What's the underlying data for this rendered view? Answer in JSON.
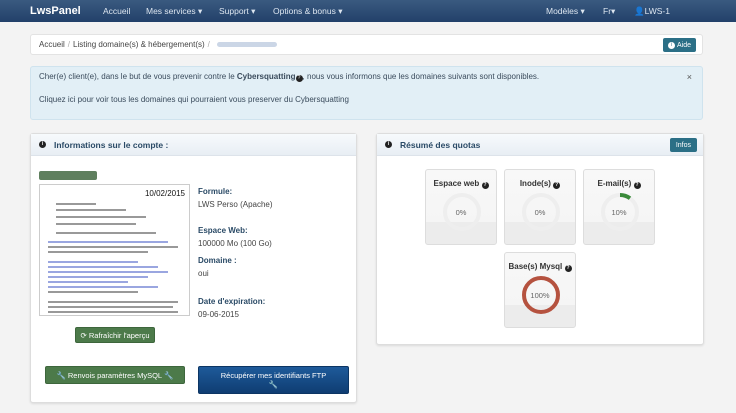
{
  "nav": {
    "brand": "LwsPanel",
    "items": [
      "Accueil",
      "Mes services ▾",
      "Support ▾",
      "Options & bonus ▾"
    ],
    "right": [
      "Modèles ▾",
      "Fr▾",
      "LWS-1"
    ]
  },
  "breadcrumb": {
    "items": [
      "Accueil",
      "Listing domaine(s) & hébergement(s)"
    ],
    "help": "Aide"
  },
  "alert": {
    "line1_pre": "Cher(e) client(e), dans le but de vous prevenir contre le ",
    "line1_bold": "Cybersquatting",
    "line1_post": ", nous vous informons que les domaines suivants sont disponibles.",
    "line2": "Cliquez ici pour voir tous les domaines qui pourraient vous preserver du Cybersquatting",
    "close": "×"
  },
  "account": {
    "title": "Informations sur le compte :",
    "preview_date": "10/02/2015",
    "refresh": "Rafraîchir l'aperçu",
    "fields": [
      {
        "label": "Formule:",
        "value": "LWS Perso (Apache)"
      },
      {
        "label": "Espace Web:",
        "value": "100000 Mo (100 Go)"
      },
      {
        "label": "Domaine :",
        "value": "oui"
      },
      {
        "label": "Date d'expiration:",
        "value": "09-06-2015"
      }
    ],
    "mysql_btn": "Renvois paramètres MySQL",
    "ftp_btn": "Récupérer mes identifiants FTP"
  },
  "quotas": {
    "title": "Résumé des quotas",
    "infos": "Infos",
    "colors": {
      "ok": "#3a8a3a",
      "full": "#b5523f",
      "track": "#eeeeee"
    },
    "items": [
      {
        "label": "Espace web",
        "percent": 0,
        "text": "0%"
      },
      {
        "label": "Inode(s)",
        "percent": 0,
        "text": "0%"
      },
      {
        "label": "E-mail(s)",
        "percent": 10,
        "text": "10%"
      },
      {
        "label": "Base(s) Mysql",
        "percent": 100,
        "text": "100%"
      }
    ]
  }
}
